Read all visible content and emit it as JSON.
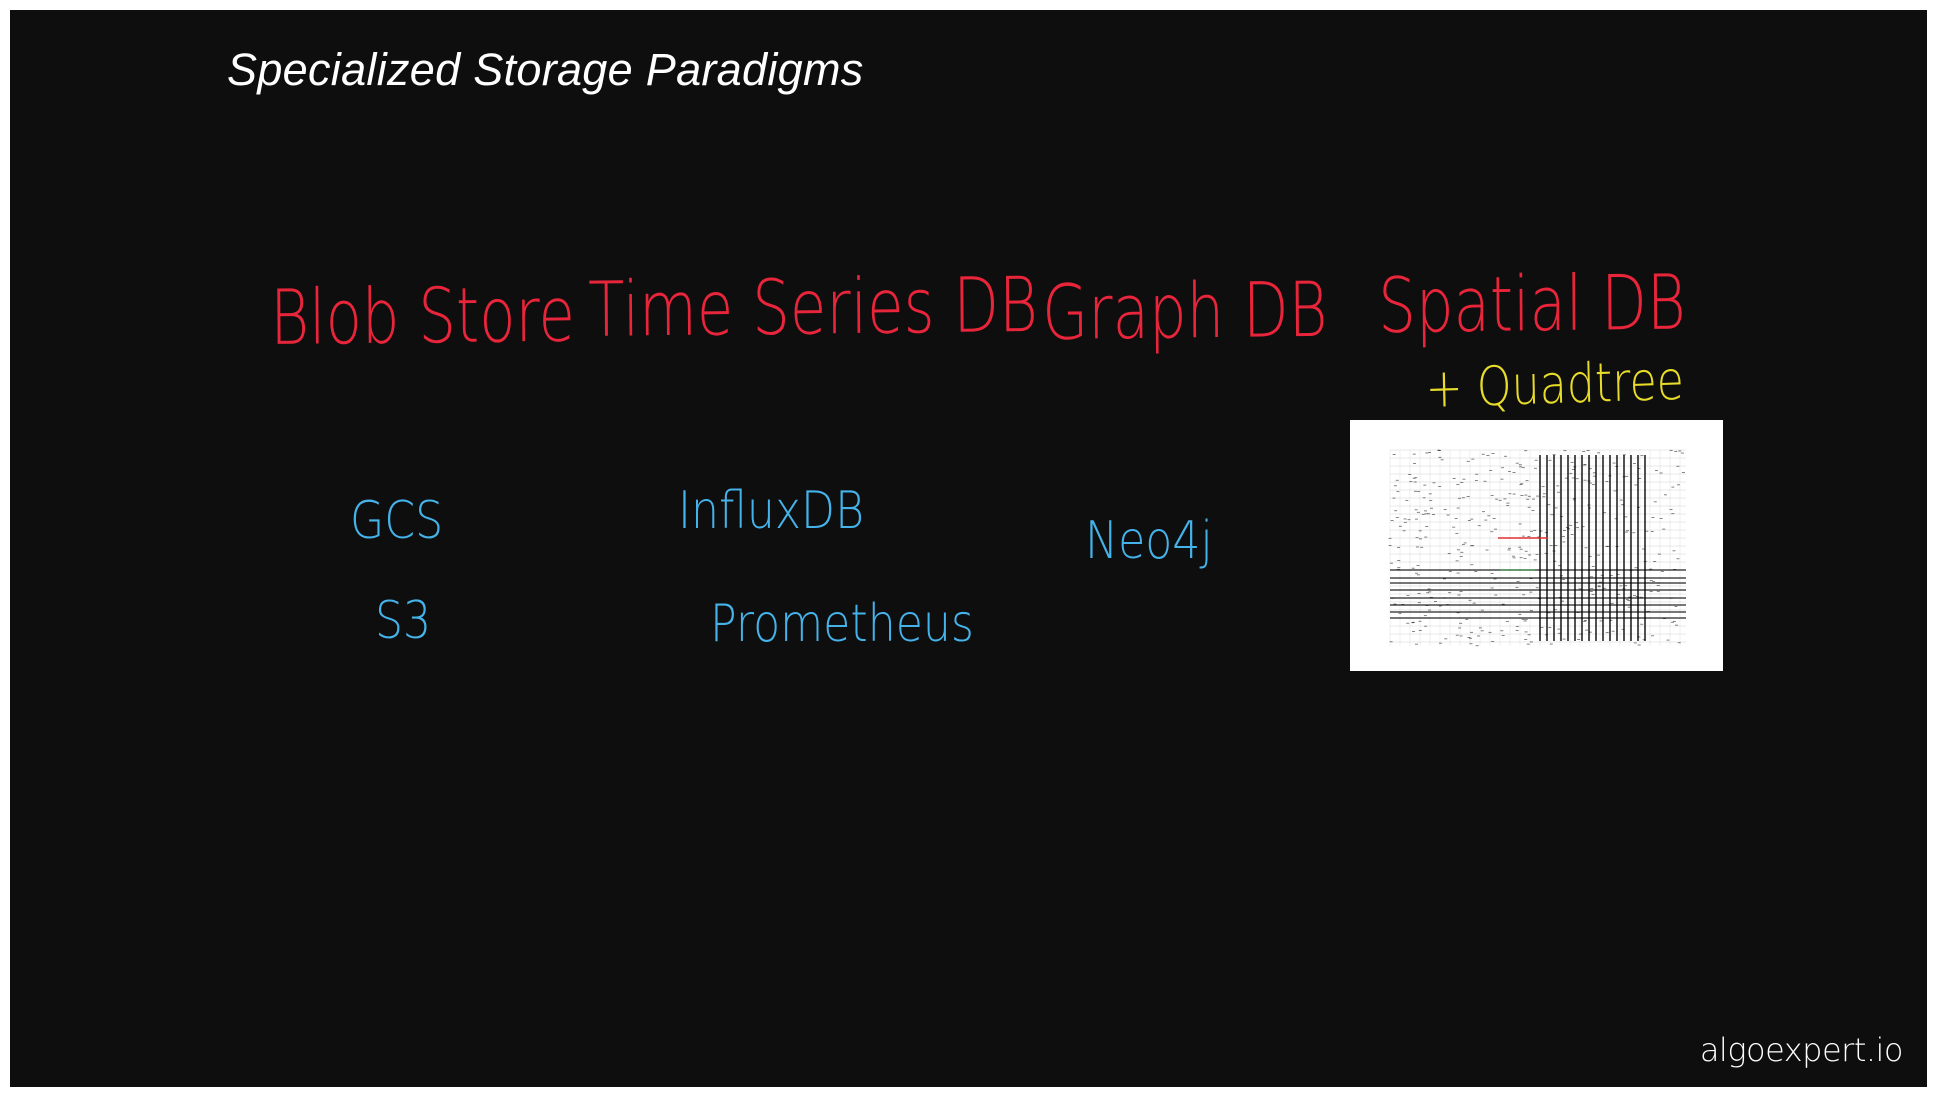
{
  "slide": {
    "title": "Specialized Storage Paradigms",
    "watermark": "algoexpert.io"
  },
  "categories": [
    {
      "label": "Blob Store",
      "examples": [
        "GCS",
        "S3"
      ]
    },
    {
      "label": "Time Series DB",
      "examples": [
        "InfluxDB",
        "Prometheus"
      ]
    },
    {
      "label": "Graph DB",
      "examples": [
        "Neo4j"
      ]
    },
    {
      "label": "Spatial DB",
      "addon": "+ Quadtree",
      "image": "quadtree-diagram"
    }
  ],
  "colors": {
    "background": "#0e0e0e",
    "category": "#e8253a",
    "example": "#45b3ea",
    "addon": "#e8dc2a",
    "text": "#ffffff"
  }
}
